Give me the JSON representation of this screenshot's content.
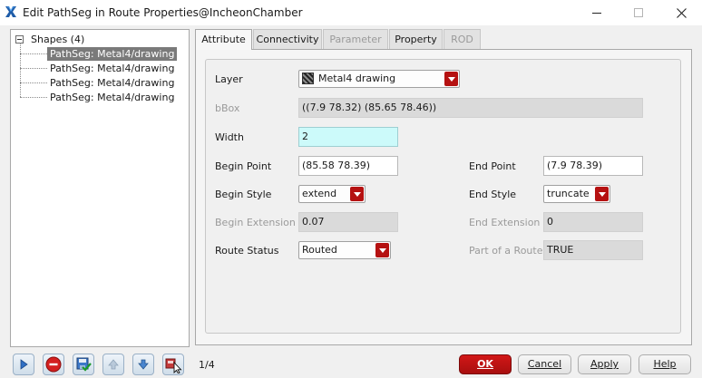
{
  "window": {
    "title": "Edit PathSeg in Route Properties@IncheonChamber"
  },
  "tree": {
    "root_label": "Shapes (4)",
    "items": [
      {
        "label": "PathSeg: Metal4/drawing",
        "selected": true
      },
      {
        "label": "PathSeg: Metal4/drawing",
        "selected": false
      },
      {
        "label": "PathSeg: Metal4/drawing",
        "selected": false
      },
      {
        "label": "PathSeg: Metal4/drawing",
        "selected": false
      }
    ]
  },
  "tabs": [
    {
      "label": "Attribute",
      "state": "active"
    },
    {
      "label": "Connectivity",
      "state": "enabled"
    },
    {
      "label": "Parameter",
      "state": "disabled"
    },
    {
      "label": "Property",
      "state": "enabled"
    },
    {
      "label": "ROD",
      "state": "disabled"
    }
  ],
  "attribute": {
    "layer": {
      "label": "Layer",
      "value": "Metal4 drawing"
    },
    "bbox": {
      "label": "bBox",
      "value": "((7.9 78.32) (85.65 78.46))"
    },
    "width": {
      "label": "Width",
      "value": "2"
    },
    "begin_point": {
      "label": "Begin Point",
      "value": "(85.58 78.39)"
    },
    "end_point": {
      "label": "End Point",
      "value": "(7.9 78.39)"
    },
    "begin_style": {
      "label": "Begin Style",
      "value": "extend"
    },
    "end_style": {
      "label": "End Style",
      "value": "truncate"
    },
    "begin_extension": {
      "label": "Begin Extension",
      "value": "0.07"
    },
    "end_extension": {
      "label": "End Extension",
      "value": "0"
    },
    "route_status": {
      "label": "Route Status",
      "value": "Routed"
    },
    "part_of_route": {
      "label": "Part of a Route",
      "value": "TRUE"
    }
  },
  "footer": {
    "page_count": "1/4",
    "ok_label": "OK",
    "cancel_label": "Cancel",
    "apply_label": "Apply",
    "help_label": "Help"
  },
  "colors": {
    "accent_red": "#b51111",
    "selected_row": "#7a7a7a",
    "width_field_bg": "#ccfafa"
  }
}
